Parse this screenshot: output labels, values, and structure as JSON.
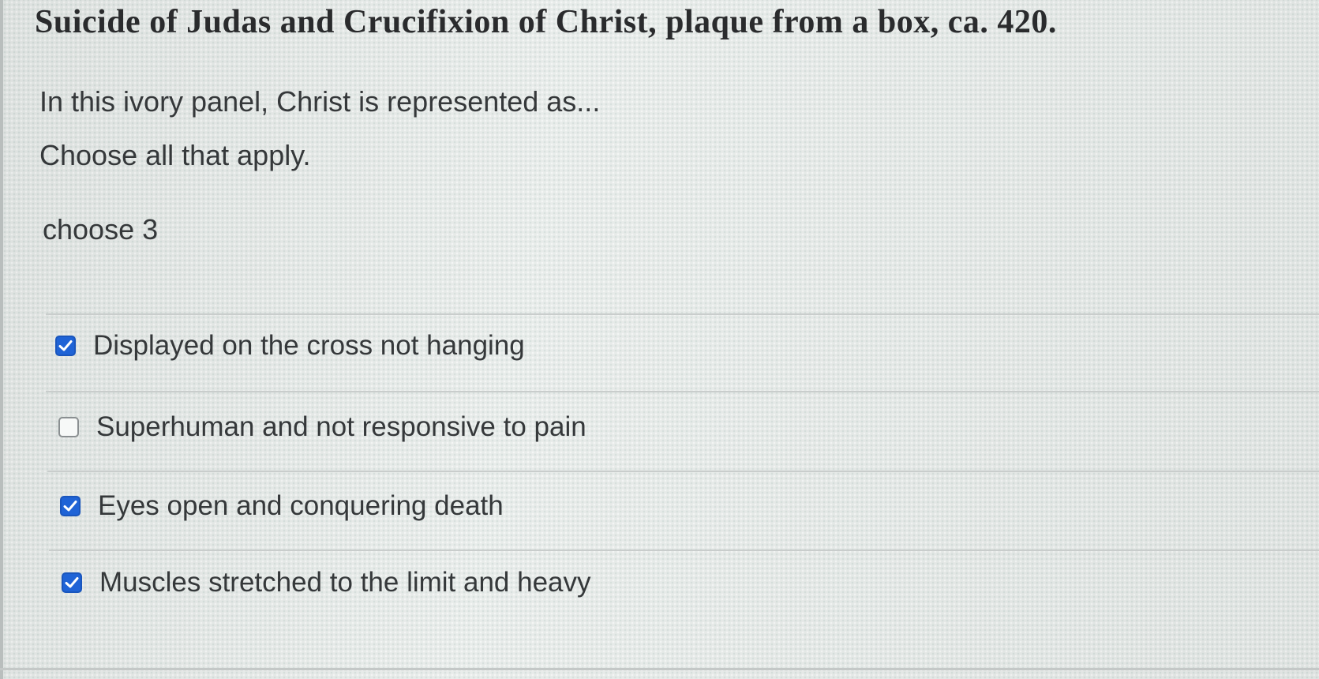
{
  "question": {
    "title": "Suicide of Judas and Crucifixion of Christ, plaque from a box, ca. 420.",
    "prompt": "In this ivory panel, Christ is represented as...",
    "instruction": "Choose all that apply.",
    "hint": "choose 3"
  },
  "options": [
    {
      "label": "Displayed on the cross not hanging",
      "checked": true
    },
    {
      "label": "Superhuman and not responsive to pain",
      "checked": false
    },
    {
      "label": "Eyes open and conquering death",
      "checked": true
    },
    {
      "label": "Muscles stretched to the limit and heavy",
      "checked": true
    }
  ],
  "colors": {
    "checkbox_checked": "#1f63d6",
    "checkbox_unchecked_border": "#8a8f91",
    "text": "#35383a"
  },
  "icons": {
    "checked": "checkmark-icon"
  }
}
